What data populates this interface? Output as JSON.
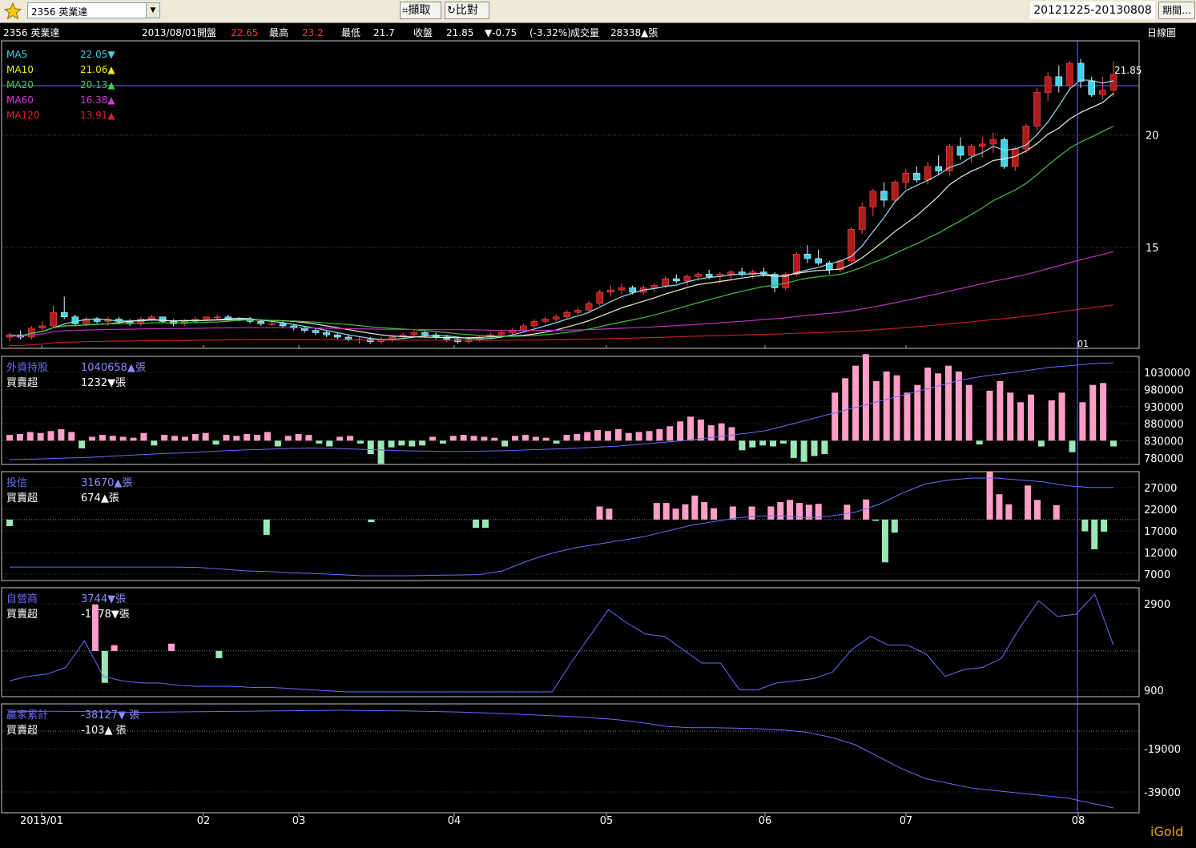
{
  "toolbar": {
    "symbol": "2356 英業達",
    "capture_label": "擷取",
    "compare_label": "比對",
    "date_range": "20121225-20130808",
    "period_label": "期間"
  },
  "header": {
    "symbol": "2356 英業達",
    "date": "2013/08/01",
    "open_label": "開盤",
    "open": "22.65",
    "high_label": "最高",
    "high": "23.2",
    "low_label": "最低",
    "low": "21.7",
    "close_label": "收盤",
    "close": "21.85",
    "change": "▼-0.75",
    "change_pct": "(-3.32%)",
    "volume_label": "成交量",
    "volume": "28338▲張",
    "chart_kind": "日線圖"
  },
  "colors": {
    "up": "#b01b1b",
    "down": "#3fd2ea",
    "ma5": "#7fd4e6",
    "ma10": "#e8e8c8",
    "ma20": "#40c040",
    "ma60": "#c030c0",
    "ma120": "#c02020",
    "buy": "#ff9ec7",
    "sell": "#9ae9b5",
    "holding_line": "#6b6bff"
  },
  "chart_data": [
    {
      "type": "candlestick",
      "title": "日線圖",
      "ma_legend": [
        {
          "name": "MA5",
          "value": "22.05",
          "dir": "▼",
          "color": "#3fd2ea"
        },
        {
          "name": "MA10",
          "value": "21.06",
          "dir": "▲",
          "color": "#f0f000"
        },
        {
          "name": "MA20",
          "value": "20.13",
          "dir": "▲",
          "color": "#40d040"
        },
        {
          "name": "MA60",
          "value": "16.38",
          "dir": "▲",
          "color": "#e030e0"
        },
        {
          "name": "MA120",
          "value": "13.91",
          "dir": "▲",
          "color": "#e02020"
        }
      ],
      "y_ticks": [
        20,
        15
      ],
      "last_price_label": "21.85",
      "ylim": [
        10.5,
        24.2
      ],
      "x_ticks": [
        "2013/01",
        "02",
        "03",
        "04",
        "05",
        "06",
        "07",
        "08"
      ],
      "cursor_label": "01",
      "candles": [
        [
          11.0,
          11.2,
          10.8,
          11.1
        ],
        [
          11.1,
          11.3,
          10.9,
          11.0
        ],
        [
          11.0,
          11.5,
          10.9,
          11.4
        ],
        [
          11.4,
          11.7,
          11.3,
          11.5
        ],
        [
          11.5,
          12.4,
          11.4,
          12.1
        ],
        [
          12.1,
          12.8,
          11.8,
          11.9
        ],
        [
          11.9,
          12.0,
          11.5,
          11.6
        ],
        [
          11.6,
          11.9,
          11.5,
          11.8
        ],
        [
          11.8,
          11.9,
          11.6,
          11.7
        ],
        [
          11.7,
          11.9,
          11.5,
          11.8
        ],
        [
          11.8,
          11.9,
          11.6,
          11.7
        ],
        [
          11.7,
          11.8,
          11.5,
          11.6
        ],
        [
          11.6,
          11.9,
          11.5,
          11.8
        ],
        [
          11.8,
          12.0,
          11.7,
          11.9
        ],
        [
          11.9,
          11.9,
          11.6,
          11.7
        ],
        [
          11.7,
          11.8,
          11.5,
          11.6
        ],
        [
          11.6,
          11.8,
          11.5,
          11.7
        ],
        [
          11.7,
          11.9,
          11.6,
          11.8
        ],
        [
          11.8,
          11.9,
          11.7,
          11.9
        ],
        [
          11.9,
          12.0,
          11.8,
          11.9
        ],
        [
          11.9,
          12.0,
          11.7,
          11.8
        ],
        [
          11.8,
          11.9,
          11.7,
          11.8
        ],
        [
          11.8,
          11.9,
          11.6,
          11.7
        ],
        [
          11.7,
          11.8,
          11.5,
          11.6
        ],
        [
          11.6,
          11.7,
          11.5,
          11.6
        ],
        [
          11.6,
          11.7,
          11.4,
          11.5
        ],
        [
          11.5,
          11.6,
          11.3,
          11.4
        ],
        [
          11.4,
          11.5,
          11.2,
          11.3
        ],
        [
          11.3,
          11.4,
          11.1,
          11.2
        ],
        [
          11.2,
          11.3,
          11.0,
          11.1
        ],
        [
          11.1,
          11.2,
          10.9,
          11.0
        ],
        [
          11.0,
          11.1,
          10.8,
          10.9
        ],
        [
          10.9,
          11.0,
          10.7,
          10.9
        ],
        [
          10.9,
          11.0,
          10.7,
          10.8
        ],
        [
          10.8,
          11.0,
          10.7,
          10.9
        ],
        [
          10.9,
          11.1,
          10.8,
          11.0
        ],
        [
          11.0,
          11.2,
          10.9,
          11.1
        ],
        [
          11.1,
          11.3,
          11.0,
          11.2
        ],
        [
          11.2,
          11.3,
          11.0,
          11.1
        ],
        [
          11.1,
          11.2,
          10.9,
          11.0
        ],
        [
          11.0,
          11.1,
          10.8,
          10.9
        ],
        [
          10.9,
          11.0,
          10.7,
          10.8
        ],
        [
          10.8,
          11.0,
          10.7,
          10.9
        ],
        [
          10.9,
          11.1,
          10.8,
          11.0
        ],
        [
          11.0,
          11.2,
          10.9,
          11.1
        ],
        [
          11.1,
          11.3,
          11.0,
          11.2
        ],
        [
          11.2,
          11.4,
          11.1,
          11.3
        ],
        [
          11.3,
          11.6,
          11.2,
          11.5
        ],
        [
          11.5,
          11.8,
          11.4,
          11.7
        ],
        [
          11.7,
          11.9,
          11.6,
          11.8
        ],
        [
          11.8,
          12.0,
          11.7,
          11.9
        ],
        [
          11.9,
          12.2,
          11.8,
          12.1
        ],
        [
          12.1,
          12.3,
          12.0,
          12.2
        ],
        [
          12.2,
          12.6,
          12.1,
          12.5
        ],
        [
          12.5,
          13.1,
          12.4,
          13.0
        ],
        [
          13.0,
          13.3,
          12.8,
          13.1
        ],
        [
          13.1,
          13.4,
          12.9,
          13.2
        ],
        [
          13.2,
          13.3,
          12.9,
          13.0
        ],
        [
          13.0,
          13.3,
          12.9,
          13.2
        ],
        [
          13.2,
          13.4,
          13.0,
          13.3
        ],
        [
          13.3,
          13.7,
          13.2,
          13.6
        ],
        [
          13.6,
          13.8,
          13.4,
          13.5
        ],
        [
          13.5,
          13.8,
          13.3,
          13.7
        ],
        [
          13.7,
          13.9,
          13.5,
          13.8
        ],
        [
          13.8,
          14.0,
          13.6,
          13.7
        ],
        [
          13.7,
          13.9,
          13.4,
          13.8
        ],
        [
          13.8,
          14.0,
          13.6,
          13.9
        ],
        [
          13.9,
          14.1,
          13.7,
          13.8
        ],
        [
          13.8,
          14.0,
          13.6,
          13.9
        ],
        [
          13.9,
          14.1,
          13.7,
          13.8
        ],
        [
          13.8,
          13.9,
          13.0,
          13.2
        ],
        [
          13.2,
          13.9,
          13.1,
          13.8
        ],
        [
          13.8,
          14.8,
          13.7,
          14.7
        ],
        [
          14.7,
          15.1,
          14.3,
          14.5
        ],
        [
          14.5,
          14.9,
          14.2,
          14.3
        ],
        [
          14.3,
          14.4,
          13.8,
          14.0
        ],
        [
          14.0,
          14.5,
          13.9,
          14.4
        ],
        [
          14.4,
          15.9,
          14.3,
          15.8
        ],
        [
          15.8,
          17.0,
          15.6,
          16.8
        ],
        [
          16.8,
          17.6,
          16.4,
          17.5
        ],
        [
          17.5,
          17.9,
          16.8,
          17.1
        ],
        [
          17.1,
          18.0,
          17.0,
          17.9
        ],
        [
          17.9,
          18.5,
          17.6,
          18.3
        ],
        [
          18.3,
          18.6,
          17.9,
          18.0
        ],
        [
          18.0,
          18.8,
          17.8,
          18.6
        ],
        [
          18.6,
          19.1,
          18.2,
          18.4
        ],
        [
          18.4,
          19.6,
          18.2,
          19.5
        ],
        [
          19.5,
          19.9,
          18.9,
          19.1
        ],
        [
          19.1,
          19.6,
          18.8,
          19.5
        ],
        [
          19.5,
          19.9,
          19.0,
          19.6
        ],
        [
          19.6,
          20.1,
          19.2,
          19.8
        ],
        [
          19.8,
          19.9,
          18.5,
          18.6
        ],
        [
          18.6,
          19.5,
          18.4,
          19.4
        ],
        [
          19.4,
          20.5,
          19.2,
          20.4
        ],
        [
          20.4,
          22.1,
          20.2,
          21.9
        ],
        [
          21.9,
          22.8,
          21.5,
          22.6
        ],
        [
          22.6,
          23.1,
          21.9,
          22.2
        ],
        [
          22.2,
          23.3,
          22.0,
          23.2
        ],
        [
          23.2,
          23.4,
          22.1,
          22.4
        ],
        [
          22.4,
          22.6,
          21.7,
          21.8
        ],
        [
          21.8,
          22.6,
          21.6,
          22.0
        ],
        [
          22.0,
          23.3,
          21.7,
          22.7
        ]
      ]
    },
    {
      "type": "bar_line",
      "name": "外資持股",
      "value_text": "1040658▲張",
      "sub_label": "買賣超",
      "sub_value": "1232▼張",
      "y_ticks": [
        1030000,
        980000,
        930000,
        880000,
        830000,
        780000
      ],
      "bars": [
        6,
        7,
        9,
        8,
        10,
        12,
        9,
        -8,
        4,
        6,
        5,
        4,
        3,
        8,
        -5,
        6,
        5,
        4,
        7,
        8,
        -4,
        6,
        5,
        7,
        6,
        9,
        -6,
        5,
        7,
        6,
        -3,
        -6,
        4,
        5,
        -3,
        -14,
        -24,
        -7,
        -5,
        -6,
        -5,
        4,
        -3,
        5,
        6,
        5,
        4,
        3,
        -6,
        5,
        6,
        4,
        3,
        -3,
        6,
        7,
        9,
        11,
        10,
        12,
        8,
        9,
        10,
        12,
        15,
        20,
        25,
        22,
        16,
        18,
        14,
        -10,
        -7,
        -5,
        -6,
        -3,
        -18,
        -22,
        -16,
        -14,
        50,
        65,
        78,
        90,
        62,
        72,
        68,
        50,
        58,
        76,
        70,
        78,
        72,
        58,
        -4,
        52,
        62,
        50,
        40,
        48,
        -6,
        42,
        50,
        -12,
        40,
        58,
        60,
        -6
      ],
      "line": [
        782000,
        783000,
        785000,
        787000,
        789000,
        792000,
        795000,
        798000,
        800000,
        803000,
        806000,
        808000,
        810000,
        812000,
        813000,
        812000,
        810000,
        808000,
        806000,
        805000,
        804000,
        804000,
        805000,
        806000,
        808000,
        810000,
        812000,
        815000,
        818000,
        822000,
        827000,
        832000,
        838000,
        845000,
        852000,
        860000,
        875000,
        890000,
        905000,
        920000,
        935000,
        950000,
        965000,
        980000,
        995000,
        1005000,
        1012000,
        1020000,
        1028000,
        1033000,
        1038000,
        1040658
      ]
    },
    {
      "type": "bar_line",
      "name": "投信",
      "value_text": "31670▲張",
      "sub_label": "買賣超",
      "sub_value": "674▲張",
      "y_ticks": [
        27000,
        22000,
        17000,
        12000,
        7000
      ],
      "bars": [
        -1500,
        0,
        0,
        0,
        0,
        0,
        0,
        0,
        0,
        0,
        0,
        0,
        0,
        0,
        0,
        0,
        0,
        0,
        0,
        0,
        0,
        0,
        0,
        0,
        0,
        0,
        0,
        -3500,
        0,
        0,
        0,
        0,
        0,
        0,
        0,
        0,
        0,
        0,
        -600,
        0,
        0,
        0,
        0,
        0,
        0,
        0,
        0,
        0,
        0,
        -1900,
        -1900,
        0,
        0,
        0,
        0,
        0,
        0,
        0,
        0,
        0,
        0,
        0,
        3000,
        2500,
        0,
        0,
        0,
        0,
        3800,
        3800,
        2500,
        3500,
        5500,
        4000,
        2600,
        0,
        3000,
        0,
        3000,
        0,
        3000,
        4000,
        4500,
        3800,
        3400,
        3600,
        0,
        0,
        3400,
        0,
        4600,
        -300,
        -9800,
        -3000,
        0,
        0,
        0,
        0,
        0,
        0,
        0,
        0,
        0,
        11000,
        5800,
        3500,
        0,
        7800,
        4500,
        0,
        3300,
        0,
        0,
        -2700,
        -6800,
        -2800,
        0
      ],
      "line": [
        7500,
        7500,
        7500,
        7500,
        7500,
        7500,
        7500,
        7500,
        7400,
        7000,
        6500,
        6300,
        6000,
        5800,
        5500,
        5200,
        5200,
        5200,
        5300,
        5400,
        5500,
        6500,
        9000,
        11000,
        12500,
        13500,
        14500,
        15500,
        17000,
        18500,
        19500,
        20500,
        21000,
        21000,
        20500,
        21000,
        22000,
        24000,
        27000,
        29500,
        30500,
        31000,
        31000,
        30500,
        30000,
        29000,
        28500,
        28500
      ]
    },
    {
      "type": "bar_line",
      "name": "自營商",
      "value_text": "3744▼張",
      "sub_label": "買賣超",
      "sub_value": "-1178▼張",
      "y_ticks": [
        2900,
        900
      ],
      "bars": [
        0,
        0,
        0,
        0,
        0,
        0,
        0,
        0,
        0,
        3200,
        -2200,
        400,
        0,
        0,
        0,
        0,
        0,
        500,
        0,
        0,
        0,
        0,
        -500,
        0,
        0,
        0,
        0,
        0,
        0,
        0,
        0,
        0,
        0,
        0,
        0,
        0,
        0,
        0,
        0,
        0,
        0,
        0,
        0,
        0,
        0,
        0,
        0,
        0,
        0,
        0,
        0,
        0,
        0,
        0,
        0,
        0,
        0,
        0,
        0,
        0,
        0,
        0,
        0,
        0,
        0,
        0,
        0,
        0,
        0,
        0,
        0,
        0,
        0,
        0,
        0,
        0,
        0,
        0,
        0,
        0,
        0,
        0,
        0,
        0,
        0,
        0,
        0,
        0,
        0,
        0,
        0,
        0,
        0,
        0,
        0,
        0,
        0,
        0,
        0,
        0,
        0,
        0,
        0,
        0,
        0,
        0,
        0,
        0,
        0,
        0,
        0,
        0,
        0,
        0,
        0,
        0,
        0
      ],
      "line": [
        1200,
        1400,
        1500,
        1800,
        3000,
        1400,
        1200,
        1100,
        1100,
        1000,
        950,
        950,
        950,
        900,
        900,
        850,
        800,
        750,
        700,
        700,
        700,
        700,
        700,
        700,
        700,
        700,
        700,
        700,
        700,
        700,
        2000,
        3200,
        4400,
        3800,
        3300,
        3200,
        2600,
        2000,
        2000,
        800,
        800,
        1100,
        1200,
        1300,
        1600,
        2600,
        3200,
        2800,
        2800,
        2400,
        1400,
        1700,
        1800,
        2200,
        3600,
        4800,
        4100,
        4200,
        5100,
        2800
      ]
    },
    {
      "type": "bar_line",
      "name": "贏家累計",
      "value_text": "-38127▼ 張",
      "sub_label": "買賣超",
      "sub_value": "-103▲ 張",
      "y_ticks": [
        -19000,
        -39000
      ],
      "bars": [],
      "line": [
        1500,
        1800,
        1800,
        1700,
        1500,
        1300,
        1400,
        1500,
        1600,
        1700,
        1800,
        1900,
        2000,
        2100,
        2200,
        2100,
        2000,
        1900,
        1700,
        1500,
        1200,
        800,
        400,
        0,
        -400,
        -1000,
        -1800,
        -3000,
        -4500,
        -5000,
        -5000,
        -5200,
        -5500,
        -6000,
        -7000,
        -9000,
        -12000,
        -17000,
        -22000,
        -26000,
        -28000,
        -30000,
        -31000,
        -32000,
        -33000,
        -34000,
        -36000,
        -38127
      ]
    }
  ],
  "brand": "iGold"
}
